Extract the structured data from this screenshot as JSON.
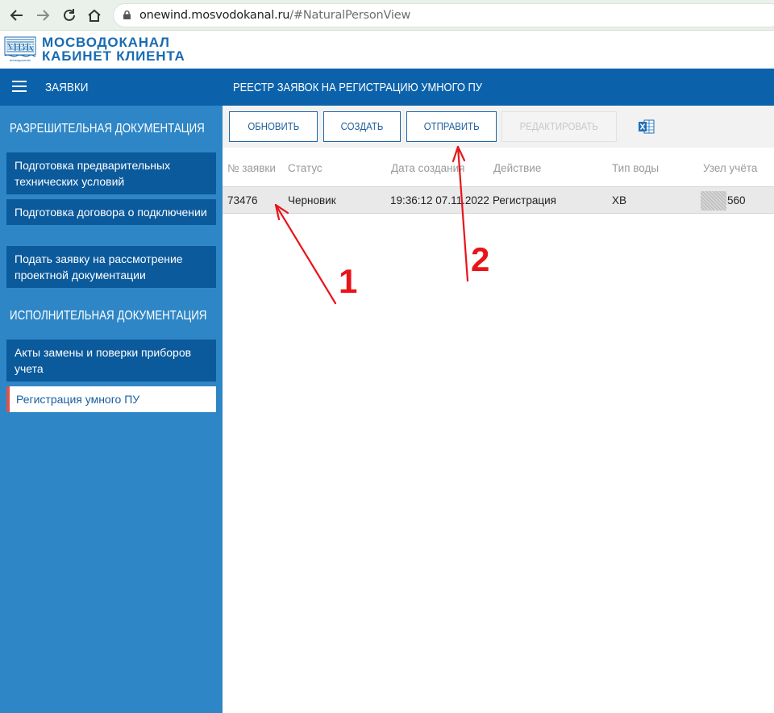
{
  "browser": {
    "url_host": "onewind.mosvodokanal.ru",
    "url_path": "/#NaturalPersonView"
  },
  "logo": {
    "mark_text": "МВК",
    "mark_subtext": "мосводоканал",
    "line1": "МОСВОДОКАНАЛ",
    "line2": "КАБИНЕТ КЛИЕНТА"
  },
  "header": {
    "section": "ЗАЯВКИ",
    "title": "РЕЕСТР ЗАЯВОК НА РЕГИСТРАЦИЮ УМНОГО ПУ"
  },
  "sidebar": {
    "heading1": "РАЗРЕШИТЕЛЬНАЯ ДОКУМЕНТАЦИЯ",
    "group1": [
      {
        "label": "Подготовка предварительных технических условий"
      },
      {
        "label": "Подготовка договора о подключении"
      },
      {
        "label": "Подать заявку на рассмотрение проектной документации"
      }
    ],
    "heading2": "ИСПОЛНИТЕЛЬНАЯ ДОКУМЕНТАЦИЯ",
    "group2": [
      {
        "label": "Акты замены и поверки приборов учета"
      },
      {
        "label": "Регистрация умного ПУ",
        "active": true
      }
    ]
  },
  "toolbar": {
    "refresh": "ОБНОВИТЬ",
    "create": "СОЗДАТЬ",
    "send": "ОТПРАВИТЬ",
    "edit": "РЕДАКТИРОВАТЬ"
  },
  "table": {
    "columns": [
      "№ заявки",
      "Статус",
      "Дата создания",
      "Действие",
      "Тип воды",
      "Узел учёта"
    ],
    "rows": [
      {
        "number": "73476",
        "status": "Черновик",
        "created": "19:36:12 07.11.2022",
        "action": "Регистрация",
        "water": "ХВ",
        "meter": "560"
      }
    ]
  },
  "annotations": {
    "label1": "1",
    "label2": "2",
    "color": "#e8141a"
  }
}
